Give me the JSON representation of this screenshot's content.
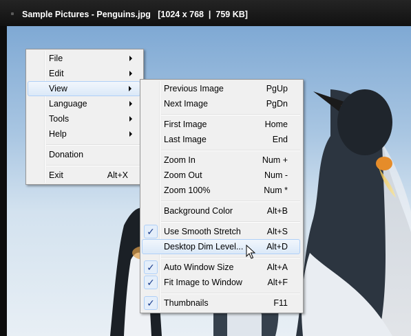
{
  "window": {
    "title": "Sample Pictures - Penguins.jpg   [1024 x 768  |  759 KB]"
  },
  "main_menu": {
    "items": [
      {
        "label": "File",
        "has_submenu": true
      },
      {
        "label": "Edit",
        "has_submenu": true
      },
      {
        "label": "View",
        "has_submenu": true,
        "highlighted": true
      },
      {
        "label": "Language",
        "has_submenu": true
      },
      {
        "label": "Tools",
        "has_submenu": true
      },
      {
        "label": "Help",
        "has_submenu": true
      },
      {
        "label": "Donation"
      },
      {
        "label": "Exit",
        "shortcut": "Alt+X"
      }
    ]
  },
  "view_menu": {
    "items": [
      {
        "label": "Previous Image",
        "shortcut": "PgUp"
      },
      {
        "label": "Next Image",
        "shortcut": "PgDn"
      },
      {
        "label": "First Image",
        "shortcut": "Home"
      },
      {
        "label": "Last Image",
        "shortcut": "End"
      },
      {
        "label": "Zoom In",
        "shortcut": "Num +"
      },
      {
        "label": "Zoom Out",
        "shortcut": "Num -"
      },
      {
        "label": "Zoom 100%",
        "shortcut": "Num *"
      },
      {
        "label": "Background Color",
        "shortcut": "Alt+B"
      },
      {
        "label": "Use Smooth Stretch",
        "shortcut": "Alt+S",
        "checked": true
      },
      {
        "label": "Desktop Dim Level...",
        "shortcut": "Alt+D",
        "highlighted": true
      },
      {
        "label": "Auto Window Size",
        "shortcut": "Alt+A",
        "checked": true
      },
      {
        "label": "Fit Image to Window",
        "shortcut": "Alt+F",
        "checked": true
      },
      {
        "label": "Thumbnails",
        "shortcut": "F11",
        "checked": true
      }
    ]
  },
  "icons": {
    "check": "✓",
    "submenu_arrow": "chevron-right-icon",
    "cursor": "mouse-pointer-icon"
  },
  "colors": {
    "highlight_border": "#aecff7",
    "menu_background": "#f0f0f0",
    "titlebar_background": "#1a1a1a"
  }
}
